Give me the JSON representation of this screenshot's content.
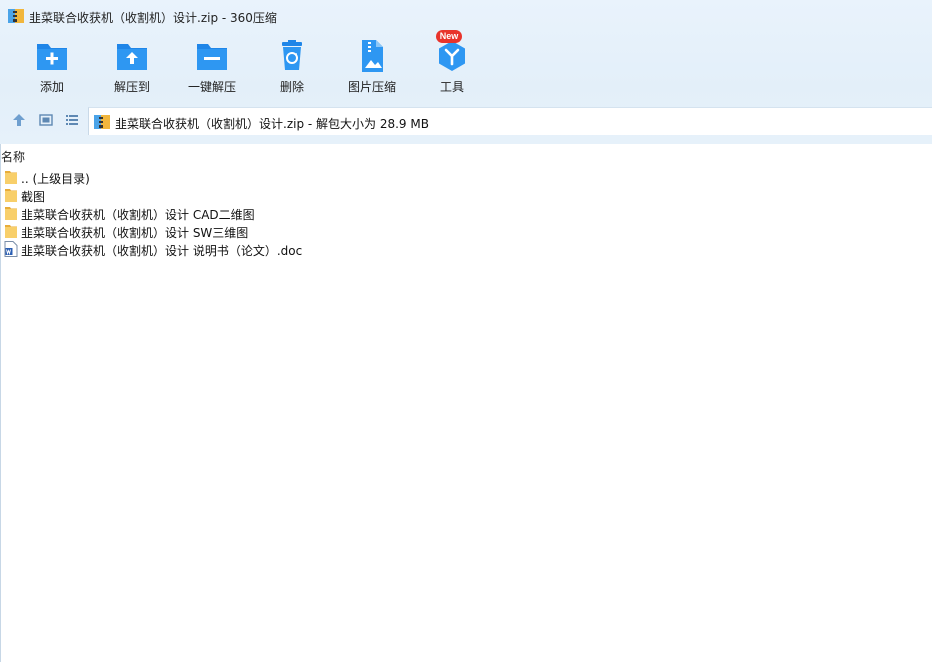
{
  "window": {
    "title": "韭菜联合收获机（收割机）设计.zip - 360压缩"
  },
  "toolbar": {
    "items": [
      {
        "label": "添加",
        "icon": "add-icon"
      },
      {
        "label": "解压到",
        "icon": "extract-to-icon"
      },
      {
        "label": "一键解压",
        "icon": "one-click-extract-icon"
      },
      {
        "label": "删除",
        "icon": "delete-icon"
      },
      {
        "label": "图片压缩",
        "icon": "image-compress-icon"
      },
      {
        "label": "工具",
        "icon": "tools-icon",
        "badge": "New"
      }
    ]
  },
  "nav": {
    "icons": [
      "up-arrow-icon",
      "view-thumbnail-icon",
      "view-list-icon"
    ]
  },
  "address": {
    "text": "韭菜联合收获机（收割机）设计.zip - 解包大小为 28.9 MB"
  },
  "columns": {
    "name": "名称"
  },
  "files": [
    {
      "name": ".. (上级目录)",
      "type": "folder"
    },
    {
      "name": "截图",
      "type": "folder"
    },
    {
      "name": "韭菜联合收获机（收割机）设计 CAD二维图",
      "type": "folder"
    },
    {
      "name": "韭菜联合收获机（收割机）设计 SW三维图",
      "type": "folder"
    },
    {
      "name": "韭菜联合收获机（收割机）设计 说明书（论文）.doc",
      "type": "doc"
    }
  ],
  "colors": {
    "accent": "#2a8df0",
    "header_bg": "#e5f0fa",
    "folder": "#f7c55a",
    "badge": "#e8342c"
  }
}
